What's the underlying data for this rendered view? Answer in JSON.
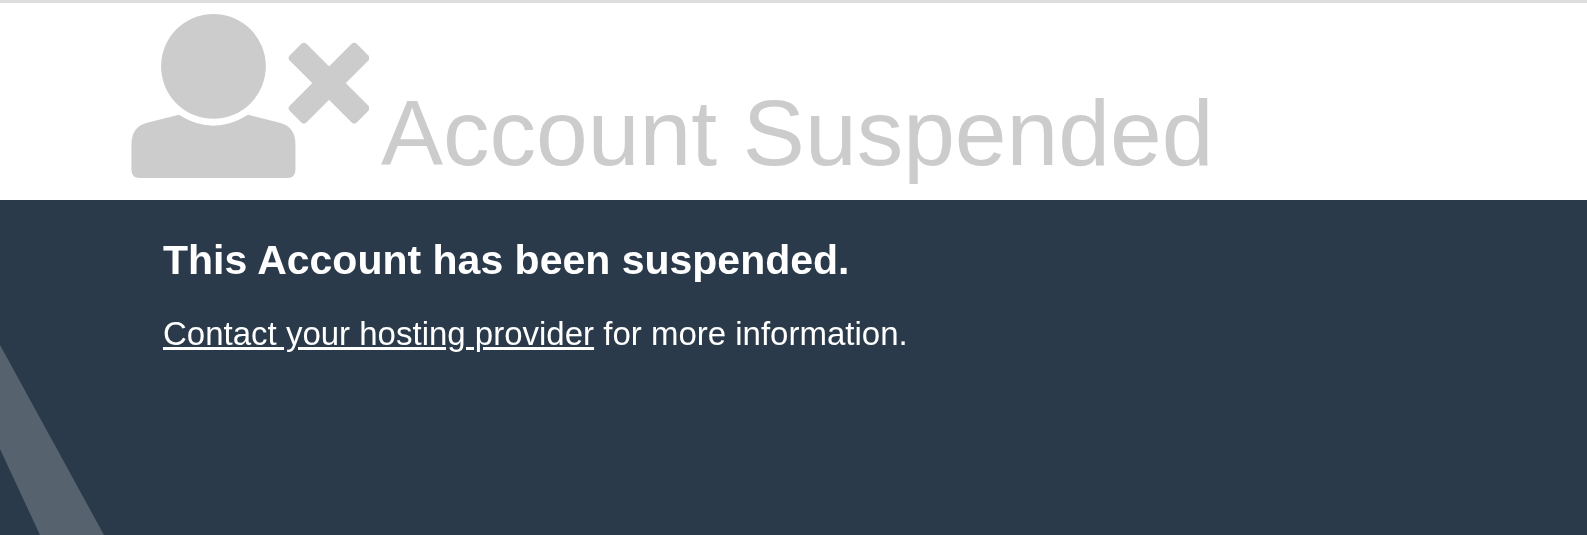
{
  "header": {
    "title": "Account Suspended"
  },
  "notice": {
    "heading": "This Account has been suspended.",
    "link": "Contact your hosting provider",
    "message": " for more information."
  }
}
